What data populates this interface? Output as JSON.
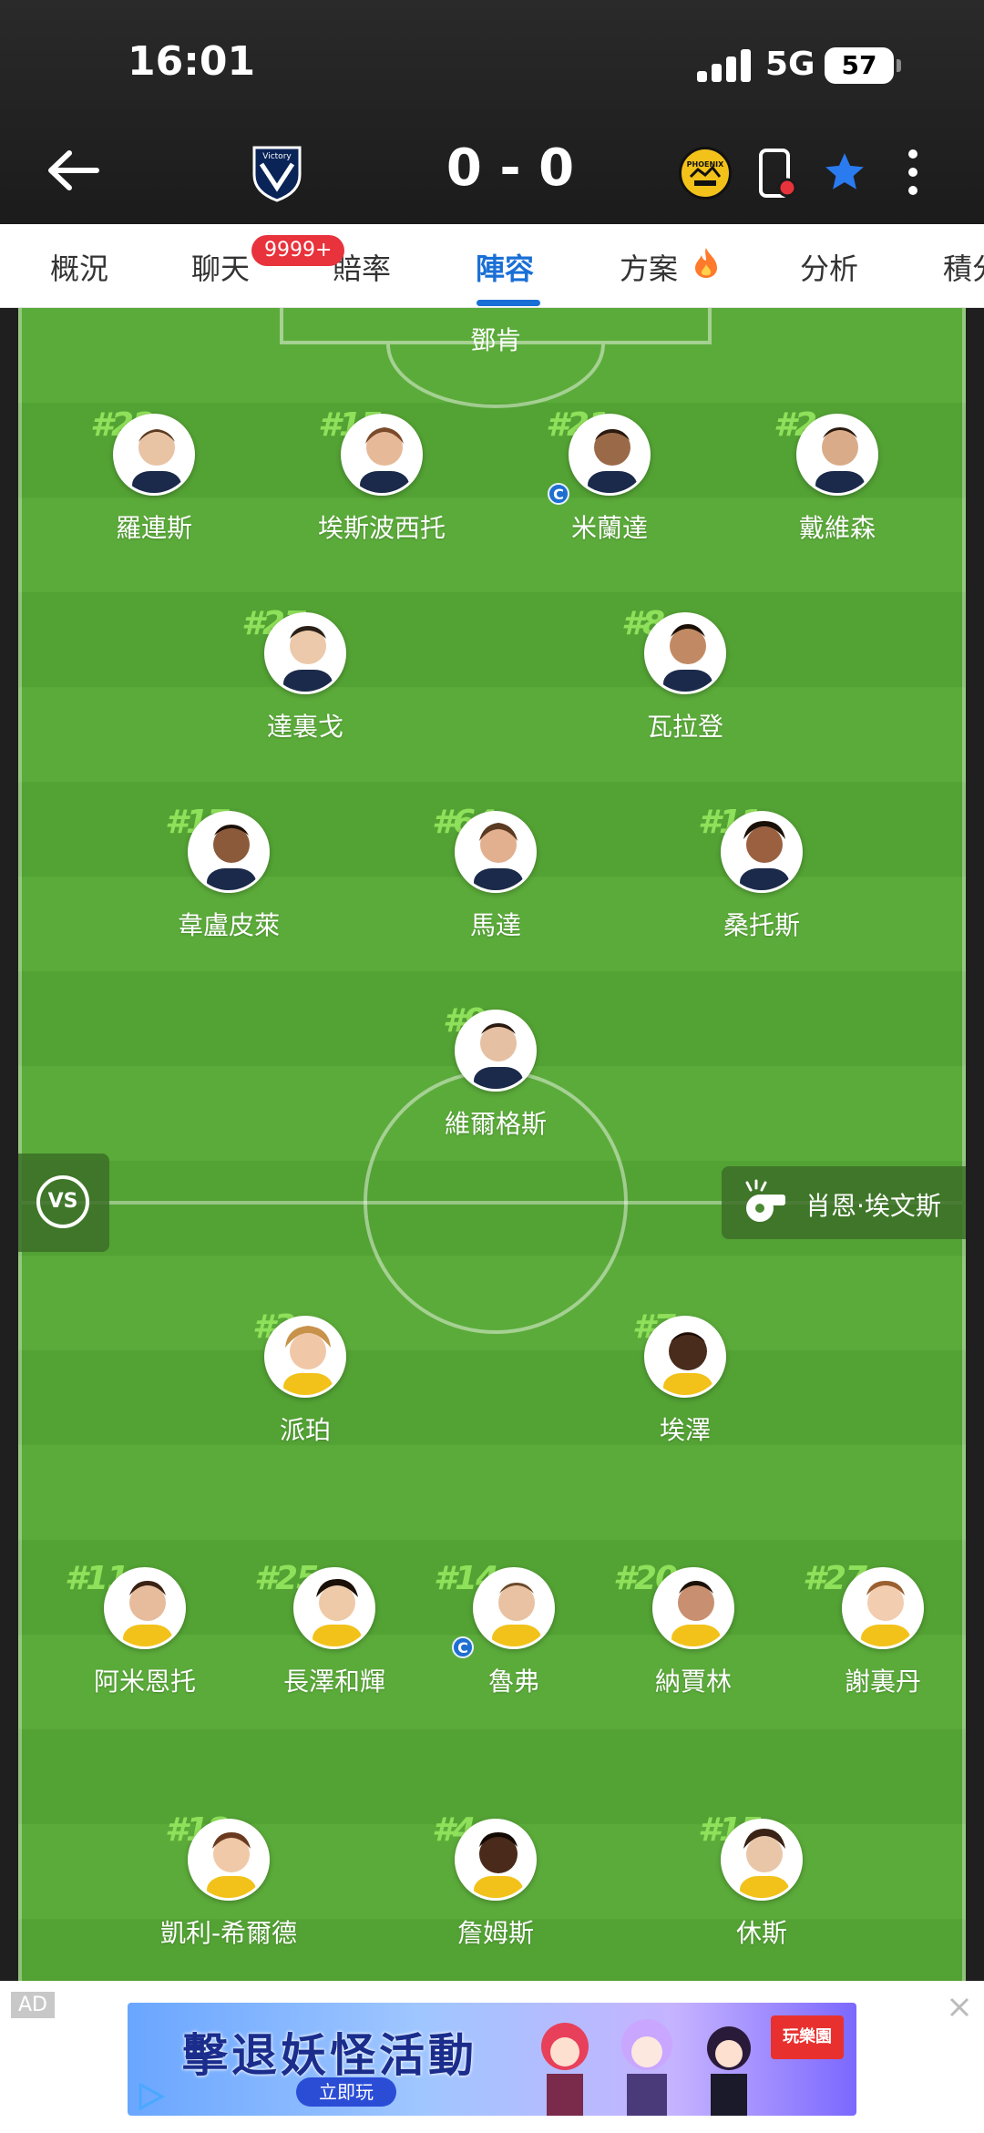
{
  "status_bar": {
    "time": "16:01",
    "network": "5G",
    "battery": "57"
  },
  "header": {
    "home_logo": "Victory",
    "score": "0 - 0",
    "away_logo": "PHOENIX"
  },
  "tabs": [
    {
      "label": "概況"
    },
    {
      "label": "聊天",
      "badge": "9999+"
    },
    {
      "label": "賠率"
    },
    {
      "label": "陣容",
      "active": true
    },
    {
      "label": "方案"
    },
    {
      "label": "分析"
    },
    {
      "label": "積分"
    }
  ],
  "pitch": {
    "top_keeper": "鄧肯",
    "top_team": [
      {
        "num": "#22",
        "name": "羅連斯"
      },
      {
        "num": "#15",
        "name": "埃斯波西托"
      },
      {
        "num": "#21",
        "name": "米蘭達",
        "captain": true
      },
      {
        "num": "#2",
        "name": "戴維森"
      },
      {
        "num": "#27",
        "name": "達裏戈"
      },
      {
        "num": "#8",
        "name": "瓦拉登"
      },
      {
        "num": "#17",
        "name": "韋盧皮萊"
      },
      {
        "num": "#64",
        "name": "馬達"
      },
      {
        "num": "#11",
        "name": "桑托斯"
      },
      {
        "num": "#9",
        "name": "維爾格斯"
      }
    ],
    "vs_label": "VS",
    "captain_mark": "C",
    "referee": "肖恩·埃文斯",
    "bottom_team": [
      {
        "num": "#3",
        "name": "派珀"
      },
      {
        "num": "#7",
        "name": "埃澤"
      },
      {
        "num": "#11",
        "name": "阿米恩托"
      },
      {
        "num": "#25",
        "name": "長澤和輝"
      },
      {
        "num": "#14",
        "name": "魯弗",
        "captain": true
      },
      {
        "num": "#20",
        "name": "納賈林"
      },
      {
        "num": "#27",
        "name": "謝裏丹"
      },
      {
        "num": "#18",
        "name": "凱利-希爾德"
      },
      {
        "num": "#4",
        "name": "詹姆斯"
      },
      {
        "num": "#15",
        "name": "休斯"
      }
    ]
  },
  "ad": {
    "tag": "AD",
    "title": "擊退妖怪活動",
    "button": "立即玩",
    "corner": "玩樂園"
  },
  "colors": {
    "accent": "#1a6fd6",
    "badge": "#e8323c",
    "pitch": "#5bab3a",
    "number": "#8fe05a"
  }
}
